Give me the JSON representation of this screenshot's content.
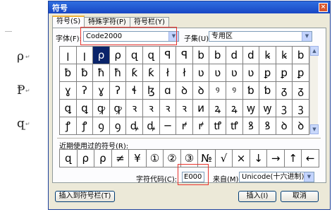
{
  "document": {
    "glyphs": [
      "ρ",
      "Ᵽ",
      "զ"
    ],
    "paragraph_mark": "↵"
  },
  "dialog": {
    "title": "符号",
    "close_label": "×",
    "tabs": [
      {
        "label": "符号(S)",
        "active": true
      },
      {
        "label": "特殊字符(P)",
        "active": false
      },
      {
        "label": "符号栏(Y)",
        "active": false
      }
    ],
    "font_label": "字体(F):",
    "font_value": "Code2000",
    "subset_label": "子集(U):",
    "subset_value": "专用区",
    "symbol_rows": [
      [
        "ꞁ",
        "ꞁ",
        "ρ",
        "ρ",
        "զ",
        "զ",
        "ꟼ",
        "ꟼ",
        "b",
        "b",
        "d",
        "d",
        "ꝃ",
        "ꝃ",
        "b"
      ],
      [
        "ƀ",
        "ƀ",
        "ħ",
        "ħ",
        "ƙ",
        "ƙ",
        "ł",
        "ł",
        "ʋ",
        "ʋ",
        "ʋ",
        "ʋ",
        "ꝑ",
        "ꝑ",
        "ꝑ"
      ],
      [
        "ɣ",
        "ʔ",
        "ɣ",
        "ʔ",
        "ɬ",
        "ɮ",
        "ɑ",
        "ꝺ",
        "ꝺ",
        "ꝰ",
        "ꝰ",
        "ƅ",
        "ƅ",
        "ᵹ",
        "ᵹ"
      ],
      [
        "ꝗ",
        "ꝗ",
        "ꝙ",
        "ꝙ",
        "ꝛ",
        "ꝛ",
        "ꝛ",
        "ꝛ",
        "ᴎ",
        "ꝝ",
        "ꝝ",
        "ꝡ",
        "ꝡ",
        "ꝫ",
        "ꝫ"
      ],
      [
        "ꝭ",
        "ꝭ",
        "ꝯ",
        "ꝯ",
        "ꝱ",
        "ꝱ",
        "─",
        "ꝵ",
        "ꝵ",
        "ꝷ",
        "ꝷ",
        "ꝸ",
        "ꝸ",
        "ꝺ",
        "ꝺ"
      ]
    ],
    "selected_cell": [
      0,
      2
    ],
    "recent_label": "近期使用过的符号(R):",
    "recent_symbols": [
      "զ",
      "ρ",
      "ρ",
      "≠",
      "¥",
      "①",
      "②",
      "③",
      "№",
      "√",
      "×",
      "↓",
      "→",
      "↑",
      "←"
    ],
    "charcode_label": "字符代码(C):",
    "charcode_value": "E000",
    "from_label": "来自(M):",
    "from_value": "Unicode(十六进制)",
    "insert_to_bar_label": "插入到符号栏(T)",
    "insert_label": "插入(I)",
    "cancel_label": "取消"
  },
  "colors": {
    "titlebar": "#1f56d4",
    "dialog_bg": "#ece9d8",
    "selection": "#0a246a",
    "highlight_box": "#e8322b"
  }
}
